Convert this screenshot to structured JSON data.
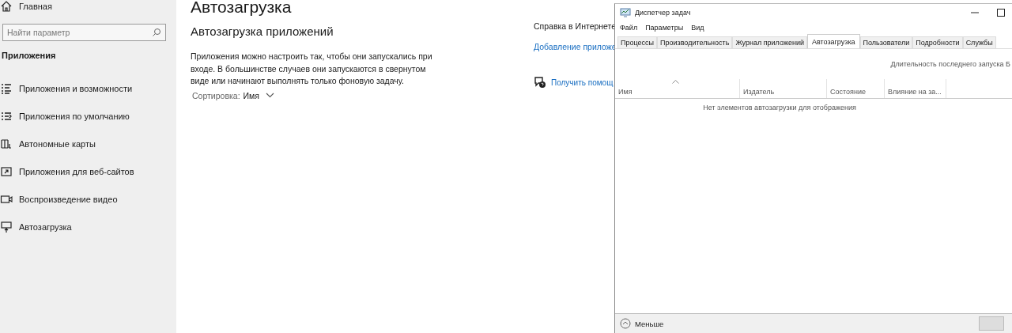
{
  "settings": {
    "sidebar": {
      "home": "Главная",
      "search": {
        "placeholder": "Найти параметр"
      },
      "section": "Приложения",
      "items": [
        {
          "label": "Приложения и возможности"
        },
        {
          "label": "Приложения по умолчанию"
        },
        {
          "label": "Автономные карты"
        },
        {
          "label": "Приложения для веб-сайтов"
        },
        {
          "label": "Воспроизведение видео"
        },
        {
          "label": "Автозагрузка"
        }
      ]
    },
    "page_title": "Автозагрузка",
    "heading": "Автозагрузка приложений",
    "description": "Приложения можно настроить так, чтобы они запускались при входе. В большинстве случаев они запускаются в свернутом виде или начинают выполнять только фоновую задачу.",
    "sort_label": "Сортировка:",
    "sort_value": "Имя",
    "help": {
      "title": "Справка в Интернете",
      "link": "Добавление приложе",
      "get_help": "Получить помощ"
    }
  },
  "task_manager": {
    "title": "Диспетчер задач",
    "menu": [
      "Файл",
      "Параметры",
      "Вид"
    ],
    "tabs": [
      {
        "label": "Процессы",
        "selected": false
      },
      {
        "label": "Производительность",
        "selected": false
      },
      {
        "label": "Журнал приложений",
        "selected": false
      },
      {
        "label": "Автозагрузка",
        "selected": true
      },
      {
        "label": "Пользователи",
        "selected": false
      },
      {
        "label": "Подробности",
        "selected": false
      },
      {
        "label": "Службы",
        "selected": false
      }
    ],
    "boot_time_label": "Длительность последнего запуска Б",
    "columns": [
      "Имя",
      "Издатель",
      "Состояние",
      "Влияние на за..."
    ],
    "empty_message": "Нет элементов автозагрузки для отображения",
    "footer": {
      "less": "Меньше"
    }
  }
}
